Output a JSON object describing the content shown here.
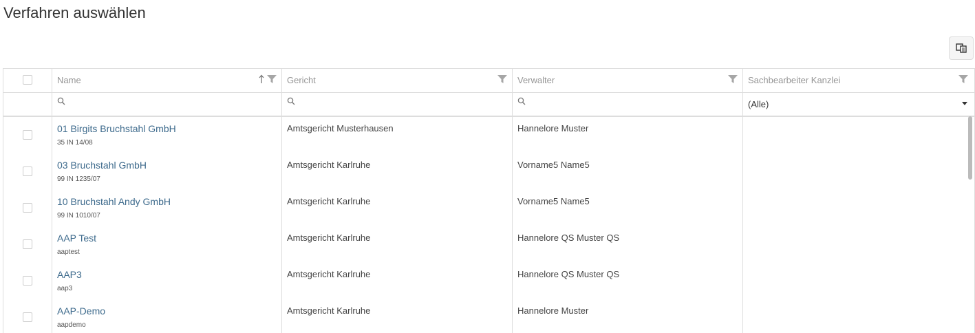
{
  "page": {
    "title": "Verfahren auswählen"
  },
  "toolbar": {
    "column_chooser_icon": "column-chooser-icon"
  },
  "grid": {
    "columns": [
      {
        "label": "Name"
      },
      {
        "label": "Gericht"
      },
      {
        "label": "Verwalter"
      },
      {
        "label": "Sachbearbeiter Kanzlei"
      }
    ],
    "filters": {
      "name": "",
      "gericht": "",
      "verwalter": "",
      "sachbearbeiter_selected": "(Alle)"
    },
    "rows": [
      {
        "name": "01 Birgits Bruchstahl GmbH",
        "sub": "35 IN 14/08",
        "gericht": "Amtsgericht Musterhausen",
        "verwalter": "Hannelore Muster",
        "sachbearbeiter": ""
      },
      {
        "name": "03 Bruchstahl GmbH",
        "sub": "99 IN 1235/07",
        "gericht": "Amtsgericht Karlruhe",
        "verwalter": "Vorname5 Name5",
        "sachbearbeiter": ""
      },
      {
        "name": "10 Bruchstahl Andy GmbH",
        "sub": "99 IN 1010/07",
        "gericht": "Amtsgericht Karlruhe",
        "verwalter": "Vorname5 Name5",
        "sachbearbeiter": ""
      },
      {
        "name": "AAP Test",
        "sub": "aaptest",
        "gericht": "Amtsgericht Karlruhe",
        "verwalter": "Hannelore QS Muster QS",
        "sachbearbeiter": ""
      },
      {
        "name": "AAP3",
        "sub": "aap3",
        "gericht": "Amtsgericht Karlruhe",
        "verwalter": "Hannelore QS Muster QS",
        "sachbearbeiter": ""
      },
      {
        "name": "AAP-Demo",
        "sub": "aapdemo",
        "gericht": "Amtsgericht Karlruhe",
        "verwalter": "Hannelore Muster",
        "sachbearbeiter": ""
      }
    ]
  },
  "colors": {
    "link": "#3d6a8c",
    "border": "#dddddd",
    "header_text": "#959595"
  }
}
